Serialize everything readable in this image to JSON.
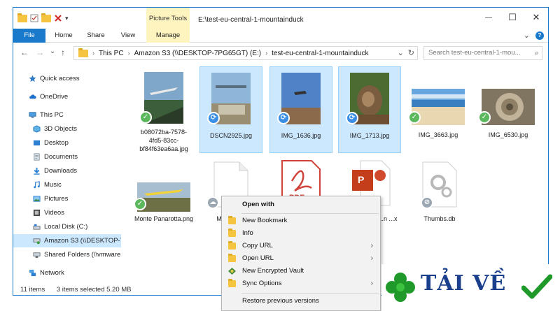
{
  "titlebar": {
    "context_tab_label": "Picture Tools",
    "path_title": "E:\\test-eu-central-1-mountainduck",
    "qat_dropdown": "▾",
    "minimize": "—",
    "maximize": "☐",
    "close": "✕"
  },
  "ribbon": {
    "tabs": [
      {
        "label": "File"
      },
      {
        "label": "Home"
      },
      {
        "label": "Share"
      },
      {
        "label": "View"
      },
      {
        "label": "Manage"
      }
    ],
    "collapse": "⌄",
    "help": "?"
  },
  "address": {
    "back": "←",
    "forward": "→",
    "recent": "⌄",
    "up": "↑",
    "crumbs": [
      "This PC",
      "Amazon S3 (\\\\DESKTOP-7PG65GT) (E:)",
      "test-eu-central-1-mountainduck"
    ],
    "dropdown": "⌄",
    "refresh": "↻",
    "search_placeholder": "Search test-eu-central-1-mou...",
    "search_icon": "⌕"
  },
  "nav": {
    "items": [
      {
        "label": "Quick access",
        "icon": "star-icon"
      },
      {
        "label": "OneDrive",
        "icon": "cloud-icon"
      },
      {
        "label": "This PC",
        "icon": "computer-icon"
      },
      {
        "label": "3D Objects",
        "icon": "cube-icon"
      },
      {
        "label": "Desktop",
        "icon": "desktop-icon"
      },
      {
        "label": "Documents",
        "icon": "document-icon"
      },
      {
        "label": "Downloads",
        "icon": "download-icon"
      },
      {
        "label": "Music",
        "icon": "music-icon"
      },
      {
        "label": "Pictures",
        "icon": "pictures-icon"
      },
      {
        "label": "Videos",
        "icon": "video-icon"
      },
      {
        "label": "Local Disk (C:)",
        "icon": "drive-icon"
      },
      {
        "label": "Amazon S3 (\\\\DESKTOP-7",
        "icon": "network-drive-icon"
      },
      {
        "label": "Shared Folders (\\\\vmware",
        "icon": "network-drive-icon"
      },
      {
        "label": "Network",
        "icon": "network-icon"
      }
    ]
  },
  "files": [
    {
      "name": "b08072ba-7578-4fd5-83cc-bf84f63ea6aa.jpg",
      "status": "synced"
    },
    {
      "name": "DSCN2925.jpg",
      "status": "syncing"
    },
    {
      "name": "IMG_1636.jpg",
      "status": "syncing"
    },
    {
      "name": "IMG_1713.jpg",
      "status": "syncing"
    },
    {
      "name": "IMG_3663.jpg",
      "status": "synced"
    },
    {
      "name": "IMG_6530.jpg",
      "status": "synced"
    },
    {
      "name": "Monte Panarotta.png",
      "status": "synced"
    },
    {
      "name": "Mo... Du...",
      "status": "cloud"
    },
    {
      "name": "",
      "status": "synced",
      "kind": "pdf",
      "kind_label": "PDF"
    },
    {
      "name": "...n ...x",
      "status": "synced",
      "kind": "pptx",
      "kind_label": "P"
    },
    {
      "name": "Thumbs.db",
      "status": "blocked"
    }
  ],
  "status_icons": {
    "synced": "✓",
    "syncing": "⟳",
    "cloud": "☁",
    "blocked": "⊘"
  },
  "statusbar": {
    "items": "11 items",
    "selected": "3 items selected  5.20 MB"
  },
  "context_menu": {
    "header": "Open with",
    "items": [
      {
        "label": "New Bookmark",
        "submenu": false
      },
      {
        "label": "Info",
        "submenu": false
      },
      {
        "label": "Copy URL",
        "submenu": true
      },
      {
        "label": "Open URL",
        "submenu": true
      },
      {
        "label": "New Encrypted Vault",
        "submenu": false
      },
      {
        "label": "Sync Options",
        "submenu": true
      }
    ],
    "footer": "Restore previous versions",
    "submenu_arrow": "›"
  },
  "watermark": {
    "text": "TẢI VỀ"
  },
  "colors": {
    "accent": "#1979ca",
    "selection": "#cce8ff",
    "synced": "#5cb85c",
    "syncing": "#3a8ee6",
    "context_tab": "#fdf4bf"
  }
}
